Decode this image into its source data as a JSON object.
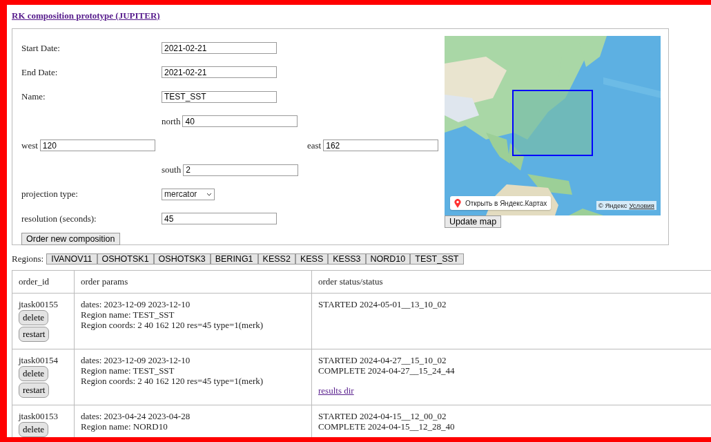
{
  "title": "RK composition prototype (JUPITER)",
  "form": {
    "dates": [
      {
        "label": "Start Date:",
        "value": "2021-02-21"
      },
      {
        "label": "End Date:",
        "value": "2021-02-21"
      },
      {
        "label": "Name:",
        "value": "TEST_SST"
      }
    ],
    "north": {
      "label": "north",
      "value": "40"
    },
    "west": {
      "label": "west",
      "value": "120"
    },
    "east": {
      "label": "east",
      "value": "162"
    },
    "south": {
      "label": "south",
      "value": "2"
    },
    "projection": {
      "label": "projection type:",
      "value": "mercator"
    },
    "resolution": {
      "label": "resolution (seconds):",
      "value": "45"
    },
    "order_button": "Order new composition"
  },
  "map": {
    "kind": "picture",
    "open_link": "Открыть в Яндекс.Картах",
    "copyright": "© Яндекс",
    "terms_link": "Условия",
    "update_button": "Update map"
  },
  "regions": {
    "label": "Regions:",
    "items": [
      "IVANOV11",
      "OSHOTSK1",
      "OSHOTSK3",
      "BERING1",
      "KESS2",
      "KESS",
      "KESS3",
      "NORD10",
      "TEST_SST"
    ]
  },
  "orders": {
    "columns": [
      "order_id",
      "order params",
      "order status/status"
    ],
    "rows": [
      {
        "order_id": "jtask00155",
        "actions": [
          "delete",
          "restart"
        ],
        "params": [
          "dates: 2023-12-09 2023-12-10",
          "Region name: TEST_SST",
          "Region coords: 2 40 162 120 res=45 type=1(merk)"
        ],
        "status": [
          "STARTED 2024-05-01__13_10_02"
        ]
      },
      {
        "order_id": "jtask00154",
        "actions": [
          "delete",
          "restart"
        ],
        "params": [
          "dates: 2023-12-09 2023-12-10",
          "Region name: TEST_SST",
          "Region coords: 2 40 162 120 res=45 type=1(merk)"
        ],
        "status": [
          "STARTED 2024-04-27__15_10_02",
          "COMPLETE 2024-04-27__15_24_44"
        ],
        "link": "results dir"
      },
      {
        "order_id": "jtask00153",
        "actions": [
          "delete"
        ],
        "params": [
          "dates: 2023-04-24 2023-04-28",
          "Region name: NORD10"
        ],
        "status": [
          "STARTED 2024-04-15__12_00_02",
          "COMPLETE 2024-04-15__12_28_40"
        ]
      }
    ]
  }
}
